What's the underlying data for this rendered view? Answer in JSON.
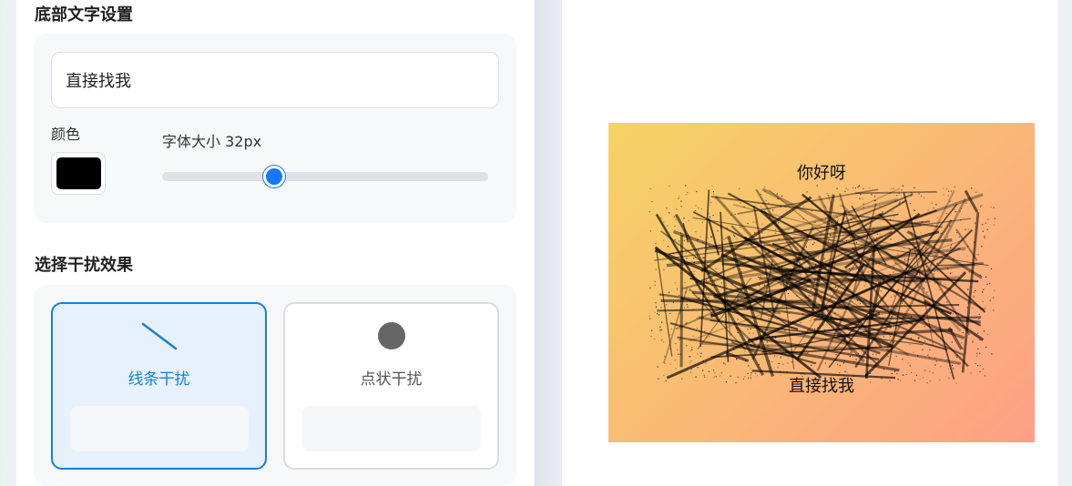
{
  "settings": {
    "bottom_text_title": "底部文字设置",
    "bottom_text_value": "直接找我",
    "color_label": "颜色",
    "color_value": "#000000",
    "font_size_label": "字体大小 32px",
    "font_size_fraction": 0.34,
    "interference_title": "选择干扰效果",
    "options": [
      {
        "label": "线条干扰",
        "icon": "line-icon",
        "selected": true
      },
      {
        "label": "点状干扰",
        "icon": "dot-icon",
        "selected": false
      }
    ]
  },
  "preview": {
    "top_text": "你好呀",
    "bottom_text": "直接找我",
    "gradient_start": "#f6d365",
    "gradient_end": "#fda085"
  }
}
